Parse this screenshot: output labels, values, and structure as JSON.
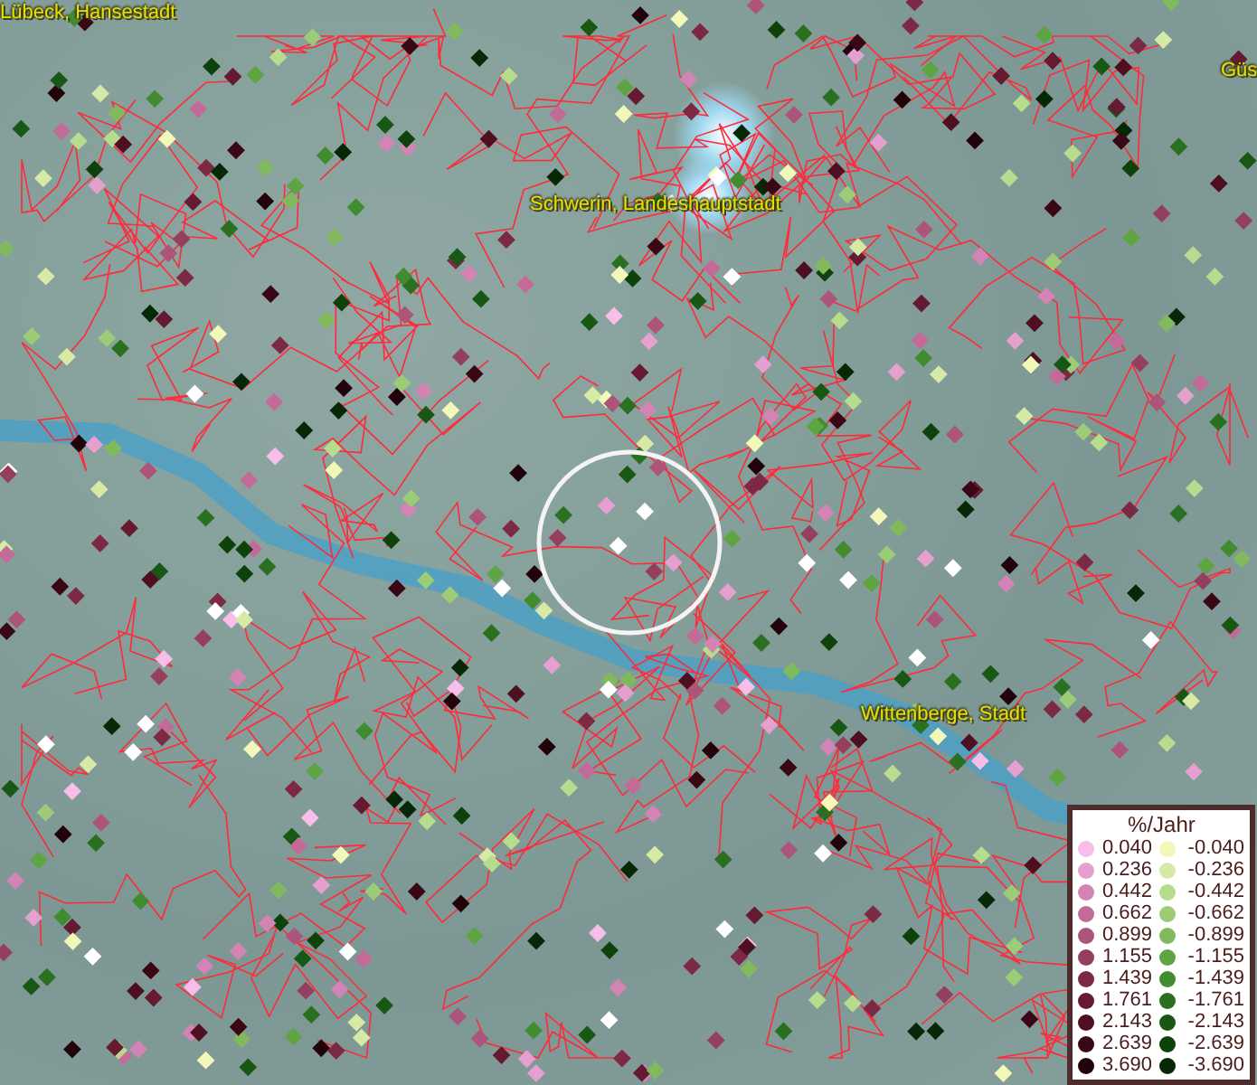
{
  "map": {
    "places": [
      {
        "name": "Lübeck, Hansestadt"
      },
      {
        "name": "Schwerin, Landeshauptstadt"
      },
      {
        "name": "Wittenberge, Stadt"
      },
      {
        "name": "Güs"
      }
    ]
  },
  "legend": {
    "title": "%/Jahr",
    "positive": [
      {
        "label": "0.040",
        "color": "#f8bde9"
      },
      {
        "label": "0.236",
        "color": "#e6a0cf"
      },
      {
        "label": "0.442",
        "color": "#d484b4"
      },
      {
        "label": "0.662",
        "color": "#c46a98"
      },
      {
        "label": "0.899",
        "color": "#ac5479"
      },
      {
        "label": "1.155",
        "color": "#953f5f"
      },
      {
        "label": "1.439",
        "color": "#7c2944"
      },
      {
        "label": "1.761",
        "color": "#661a31"
      },
      {
        "label": "2.143",
        "color": "#4e0f20"
      },
      {
        "label": "2.639",
        "color": "#3a0815"
      },
      {
        "label": "3.690",
        "color": "#22030b"
      }
    ],
    "negative": [
      {
        "label": "-0.040",
        "color": "#f2f8b8"
      },
      {
        "label": "-0.236",
        "color": "#d6eaa6"
      },
      {
        "label": "-0.442",
        "color": "#b8dc8e"
      },
      {
        "label": "-0.662",
        "color": "#9ccc78"
      },
      {
        "label": "-0.899",
        "color": "#80ba5c"
      },
      {
        "label": "-1.155",
        "color": "#5ea443"
      },
      {
        "label": "-1.439",
        "color": "#418c31"
      },
      {
        "label": "-1.761",
        "color": "#2a7020"
      },
      {
        "label": "-2.143",
        "color": "#185814"
      },
      {
        "label": "-2.639",
        "color": "#0e420b"
      },
      {
        "label": "-3.690",
        "color": "#062806"
      }
    ]
  }
}
